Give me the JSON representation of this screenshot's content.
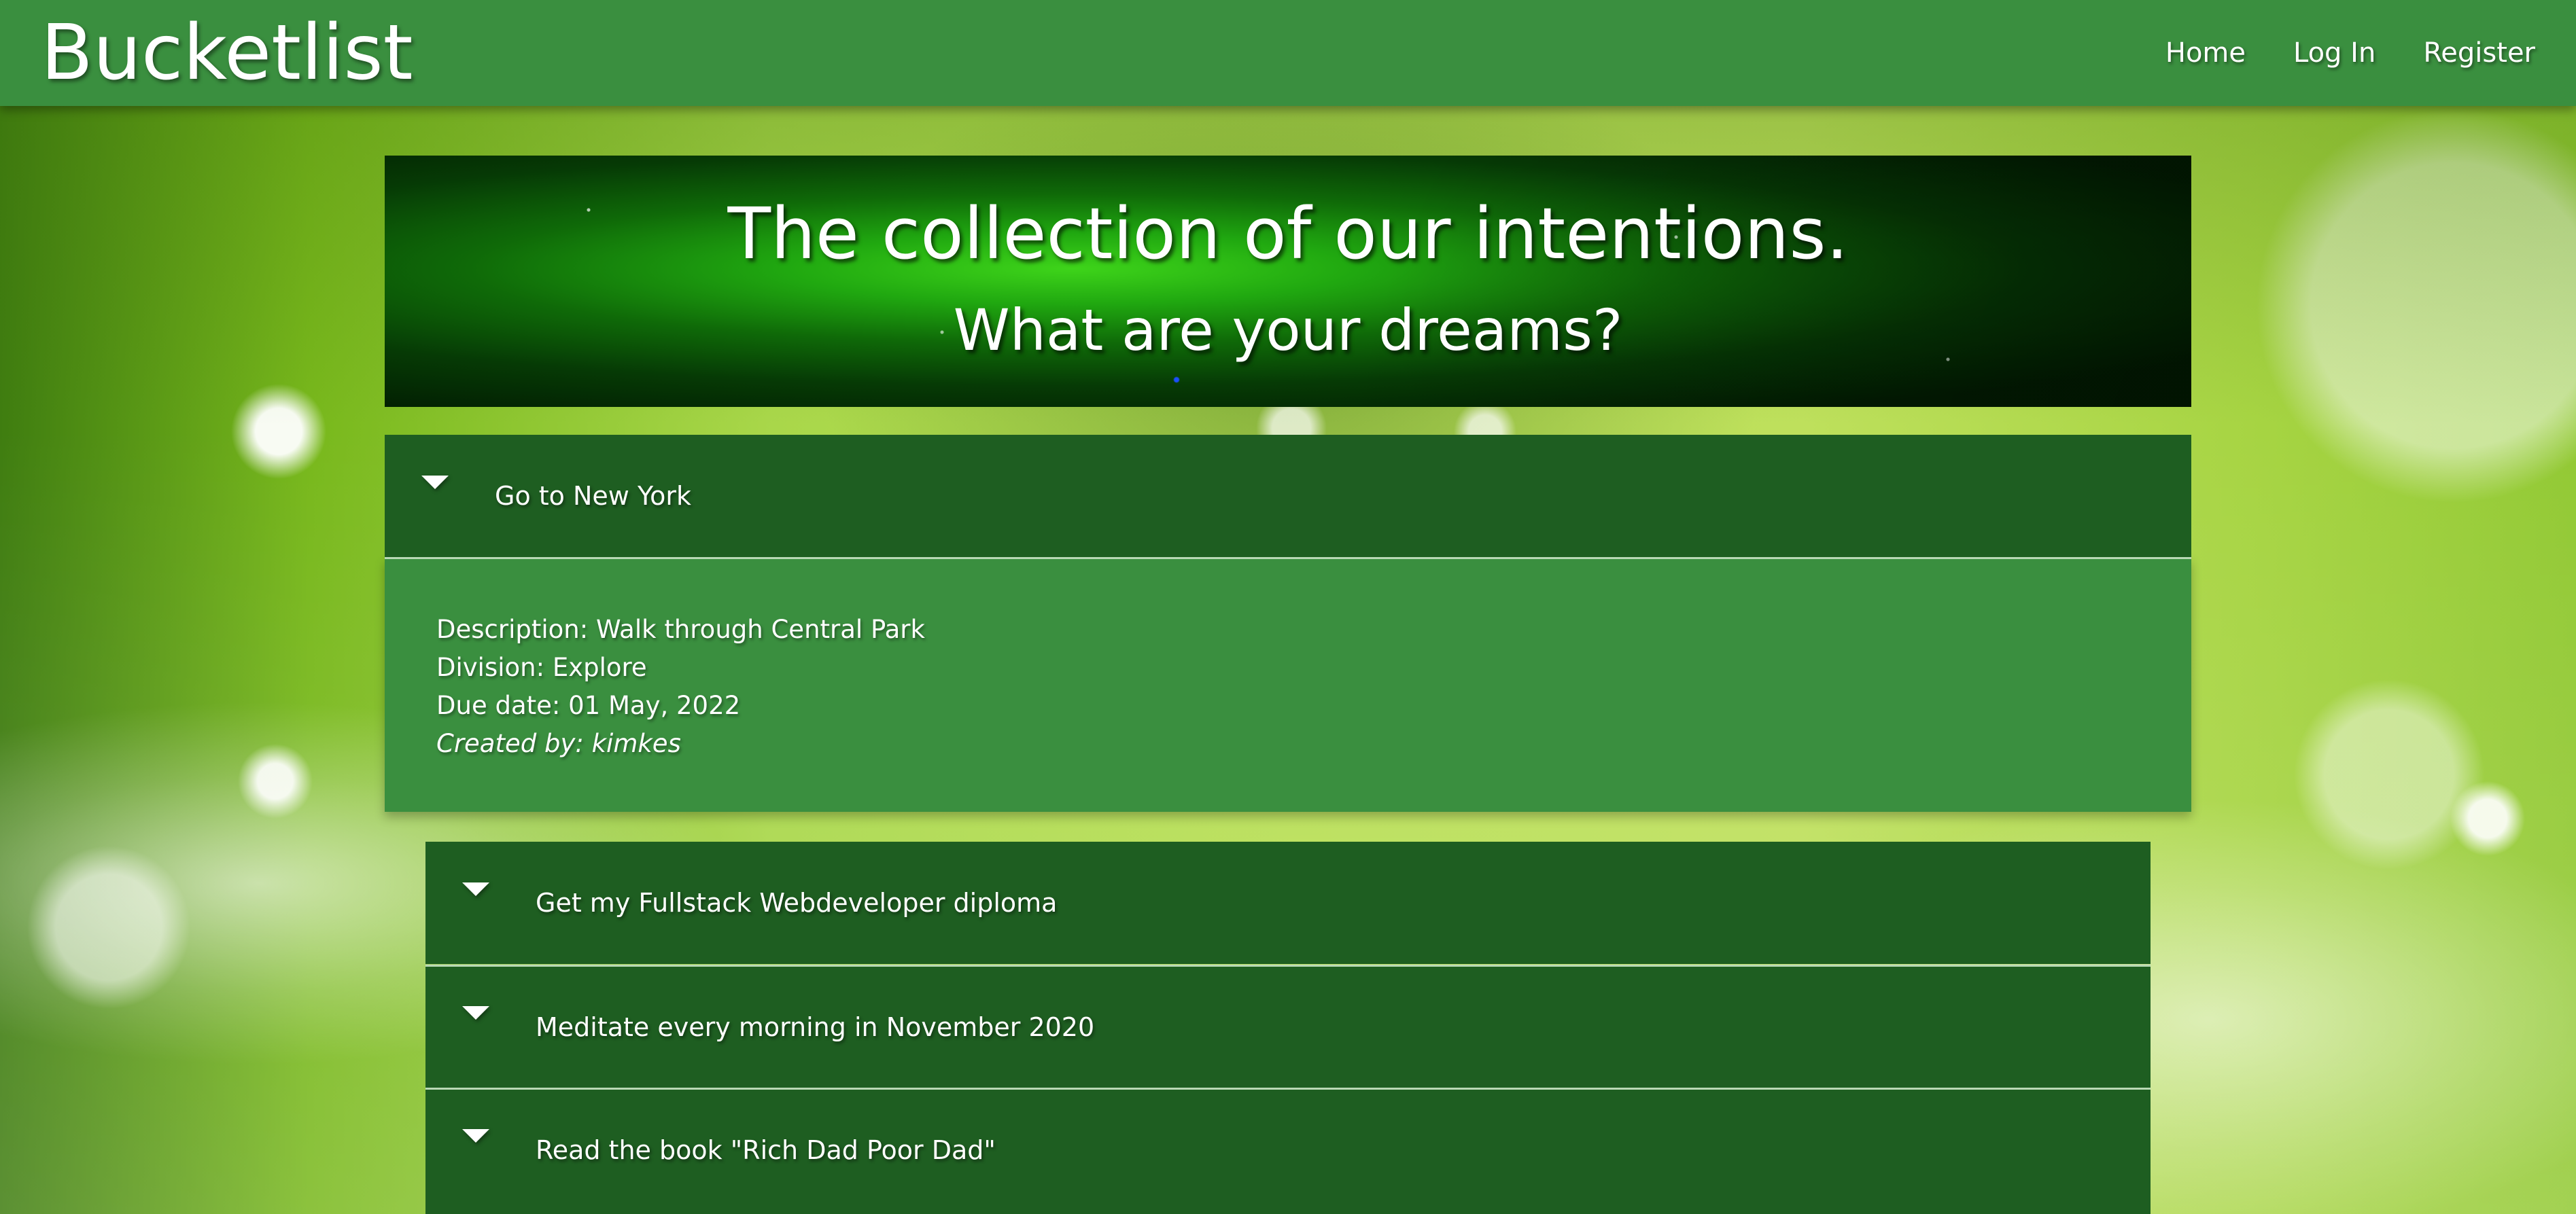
{
  "navbar": {
    "brand": "Bucketlist",
    "links": [
      "Home",
      "Log In",
      "Register"
    ]
  },
  "hero": {
    "title": "The collection of our intentions.",
    "subtitle": "What are your dreams?"
  },
  "items": [
    {
      "title": "Go to New York",
      "expanded": true,
      "description_label": "Description:",
      "description": "Walk through Central Park",
      "division_label": "Division:",
      "division": "Explore",
      "due_label": "Due date:",
      "due": "01 May, 2022",
      "created_label": "Created by:",
      "created_by": "kimkes"
    },
    {
      "title": "Get my Fullstack Webdeveloper diploma",
      "expanded": false
    },
    {
      "title": "Meditate every morning in November 2020",
      "expanded": false
    },
    {
      "title": "Read the book \"Rich Dad Poor Dad\"",
      "expanded": false
    }
  ],
  "colors": {
    "navbar": "#3a8f3f",
    "item_header": "#1e5e21",
    "item_body": "#3a8f3f",
    "text": "#ffffff"
  },
  "icons": {
    "expand": "caret-down-icon"
  }
}
